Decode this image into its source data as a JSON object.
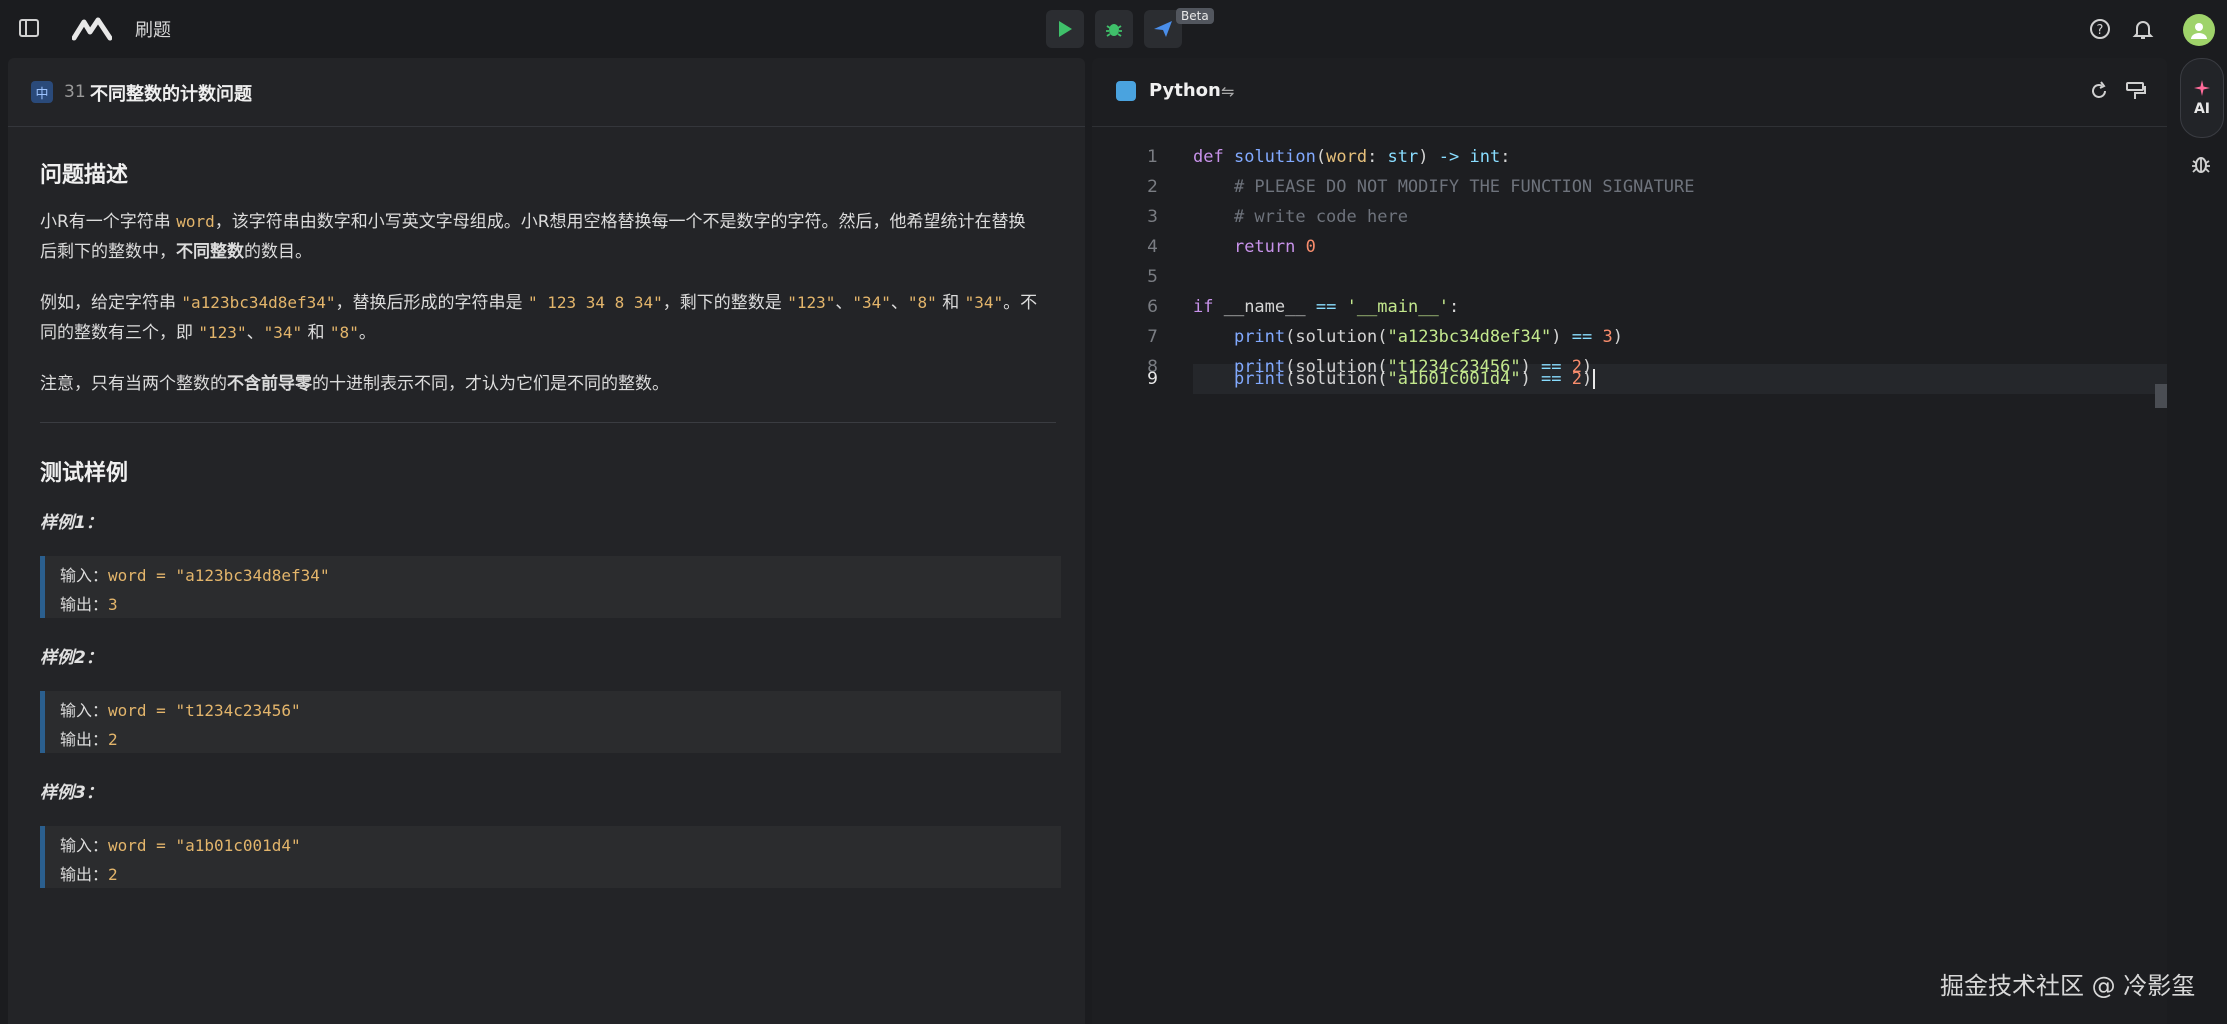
{
  "topbar": {
    "breadcrumb": "刷题",
    "beta_label": "Beta"
  },
  "problem": {
    "difficulty_badge": "中",
    "number": "31",
    "title": "不同整数的计数问题",
    "section_description": "问题描述",
    "para1_a": "小R有一个字符串 ",
    "para1_code": "word",
    "para1_b": "，该字符串由数字和小写英文字母组成。小R想用空格替换每一个不是数字的字符。然后，他希望统计在替换",
    "para1_c": "后剩下的整数中，",
    "para1_bold": "不同整数",
    "para1_d": "的数目。",
    "para2_a": "例如，给定字符串 ",
    "para2_code1": "\"a123bc34d8ef34\"",
    "para2_b": "，替换后形成的字符串是 ",
    "para2_code2": "\" 123 34 8 34\"",
    "para2_c": "，剩下的整数是 ",
    "para2_code3": "\"123\"",
    "para2_sep1": "、",
    "para2_code4": "\"34\"",
    "para2_sep2": "、",
    "para2_code5": "\"8\"",
    "para2_and": " 和 ",
    "para2_code6": "\"34\"",
    "para2_d": "。不",
    "para2_e": "同的整数有三个，即 ",
    "para2_code7": "\"123\"",
    "para2_sep3": "、",
    "para2_code8": "\"34\"",
    "para2_and2": " 和 ",
    "para2_code9": "\"8\"",
    "para2_f": "。",
    "para3_a": "注意，只有当两个整数的",
    "para3_bold": "不含前导零",
    "para3_b": "的十进制表示不同，才认为它们是不同的整数。",
    "section_examples": "测试样例",
    "examples": [
      {
        "label": "样例1：",
        "input_label": "输入：",
        "input": "word = \"a123bc34d8ef34\"",
        "output_label": "输出：",
        "output": "3"
      },
      {
        "label": "样例2：",
        "input_label": "输入：",
        "input": "word = \"t1234c23456\"",
        "output_label": "输出：",
        "output": "2"
      },
      {
        "label": "样例3：",
        "input_label": "输入：",
        "input": "word = \"a1b01c001d4\"",
        "output_label": "输出：",
        "output": "2"
      }
    ]
  },
  "editor": {
    "language": "Python",
    "line_numbers": [
      "1",
      "2",
      "3",
      "4",
      "5",
      "6",
      "7",
      "8",
      "9"
    ],
    "lines": [
      {
        "def": "def",
        "sp1": " ",
        "fn": "solution",
        "p1": "(",
        "param": "word",
        "colon": ": ",
        "type": "str",
        "p2": ") ",
        "arrow": "->",
        "sp2": " ",
        "ret": "int",
        "end": ":"
      },
      {
        "comment": "    # PLEASE DO NOT MODIFY THE FUNCTION SIGNATURE"
      },
      {
        "comment": "    # write code here"
      },
      {
        "indent": "    ",
        "kw": "return",
        "sp": " ",
        "num": "0"
      },
      {},
      {
        "kw": "if",
        "a": " __name__ ",
        "op": "==",
        "sp": " ",
        "str": "'__main__'",
        "end": ":"
      },
      {
        "indent": "    ",
        "fn": "print",
        "a": "(solution(",
        "str": "\"a123bc34d8ef34\"",
        "b": ") ",
        "op": "==",
        "sp": " ",
        "num": "3",
        "end": ")"
      },
      {
        "indent": "    ",
        "fn": "print",
        "a": "(solution(",
        "str": "\"t1234c23456\"",
        "b": ") ",
        "op": "==",
        "sp": " ",
        "num": "2",
        "end": ")"
      },
      {
        "indent": "    ",
        "fn": "print",
        "a": "(solution(",
        "str": "\"a1b01c001d4\"",
        "b": ") ",
        "op": "==",
        "sp": " ",
        "num": "2",
        "end": ")"
      }
    ]
  },
  "rail": {
    "ai_label": "AI"
  },
  "watermark": "掘金技术社区 @ 冷影玺"
}
